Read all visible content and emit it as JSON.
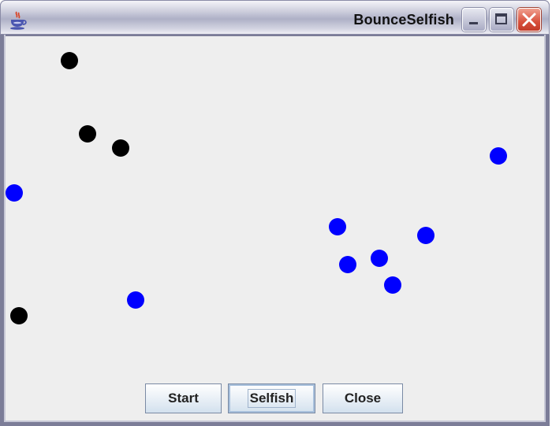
{
  "window": {
    "title": "BounceSelfish",
    "app_icon": "java-coffee-cup-icon",
    "controls": {
      "minimize": "minimize-icon",
      "maximize": "maximize-icon",
      "close": "close-icon"
    }
  },
  "colors": {
    "ball_black": "#000000",
    "ball_blue": "#0000ff",
    "canvas_bg": "#eeeeee"
  },
  "balls": [
    {
      "color": "black"
    },
    {
      "color": "black"
    },
    {
      "color": "black"
    },
    {
      "color": "black"
    },
    {
      "color": "blue"
    },
    {
      "color": "blue"
    },
    {
      "color": "blue"
    },
    {
      "color": "blue"
    },
    {
      "color": "blue"
    },
    {
      "color": "blue"
    },
    {
      "color": "blue"
    },
    {
      "color": "blue"
    }
  ],
  "buttons": {
    "start": "Start",
    "selfish": "Selfish",
    "close": "Close"
  }
}
